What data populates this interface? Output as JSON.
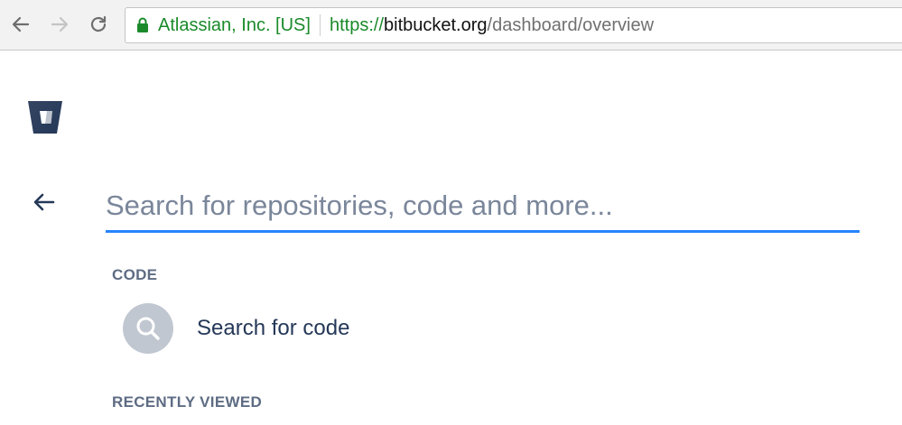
{
  "browser": {
    "cert_name": "Atlassian, Inc. [US]",
    "url_scheme": "https://",
    "url_host": "bitbucket.org",
    "url_path": "/dashboard/overview"
  },
  "icons": {
    "back": "arrow-left-icon",
    "forward": "arrow-right-icon",
    "reload": "reload-icon",
    "lock": "lock-icon",
    "logo": "bitbucket-logo",
    "search": "search-icon"
  },
  "search": {
    "placeholder": "Search for repositories, code and more..."
  },
  "sections": {
    "code_heading": "CODE",
    "code_result": "Search for code",
    "recent_heading": "RECENTLY VIEWED"
  },
  "colors": {
    "accent": "#2684ff",
    "brand": "#253858",
    "secure_green": "#1a8a2a"
  }
}
